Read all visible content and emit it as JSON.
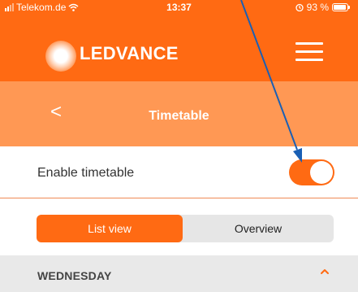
{
  "status_bar": {
    "carrier": "Telekom.de",
    "time": "13:37",
    "battery": "93 %"
  },
  "app_bar": {
    "brand": "LEDVANCE"
  },
  "title_bar": {
    "back_glyph": "<",
    "title": "Timetable"
  },
  "enable_row": {
    "label": "Enable timetable",
    "toggle_on": true
  },
  "segmented": {
    "selected": "List view",
    "options": [
      "List view",
      "Overview"
    ]
  },
  "day": {
    "label": "WEDNESDAY",
    "expanded": true
  },
  "colors": {
    "brand_orange": "#ff6a13",
    "title_orange": "#ff9854",
    "annotation_arrow": "#1a5fb4"
  },
  "icons": {
    "wifi": "wifi-icon",
    "alarm": "alarm-icon",
    "menu": "hamburger-menu-icon",
    "chevron": "chevron-up-icon"
  }
}
